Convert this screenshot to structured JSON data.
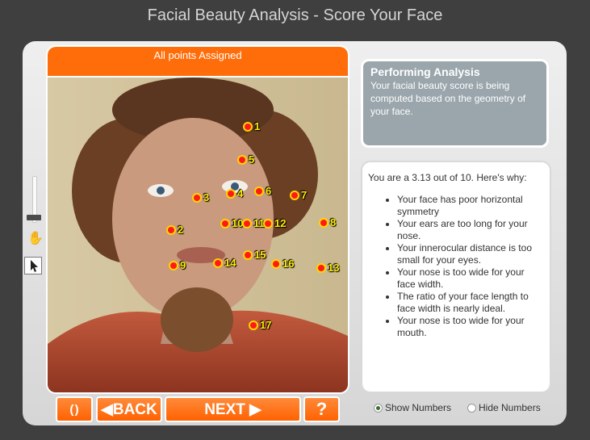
{
  "app": {
    "title": "Facial Beauty Analysis - Score Your Face"
  },
  "status": {
    "message": "All points Assigned"
  },
  "points": [
    "1",
    "2",
    "3",
    "4",
    "5",
    "6",
    "7",
    "8",
    "9",
    "10",
    "11",
    "12",
    "13",
    "14",
    "15",
    "16",
    "17"
  ],
  "analysis": {
    "title": "Performing Analysis",
    "text": "Your facial beauty score is being computed based on the geometry of your face."
  },
  "result": {
    "summary": "You are a 3.13 out of 10.  Here's why:",
    "reasons": [
      "Your face has poor horizontal symmetry",
      "Your ears are too long for your nose.",
      "Your innerocular distance is too small for your eyes.",
      "Your nose is too wide for your face width.",
      "The ratio of your face length to face width is nearly ideal.",
      "Your nose is too wide for your mouth."
    ]
  },
  "nav": {
    "reset_label": "( )",
    "back_label": "◀BACK",
    "next_label": "NEXT ▶",
    "help_label": "?"
  },
  "options": {
    "show_numbers": "Show Numbers",
    "hide_numbers": "Hide Numbers",
    "selected": "show_numbers"
  },
  "colors": {
    "accent": "#ff6d0a",
    "point_fill": "#ff1a1a",
    "point_ring": "#ffd400",
    "label": "#ffee00"
  },
  "icons": {
    "zoom": "zoom-slider",
    "hand": "hand-icon",
    "pointer": "pointer-arrow-icon"
  }
}
